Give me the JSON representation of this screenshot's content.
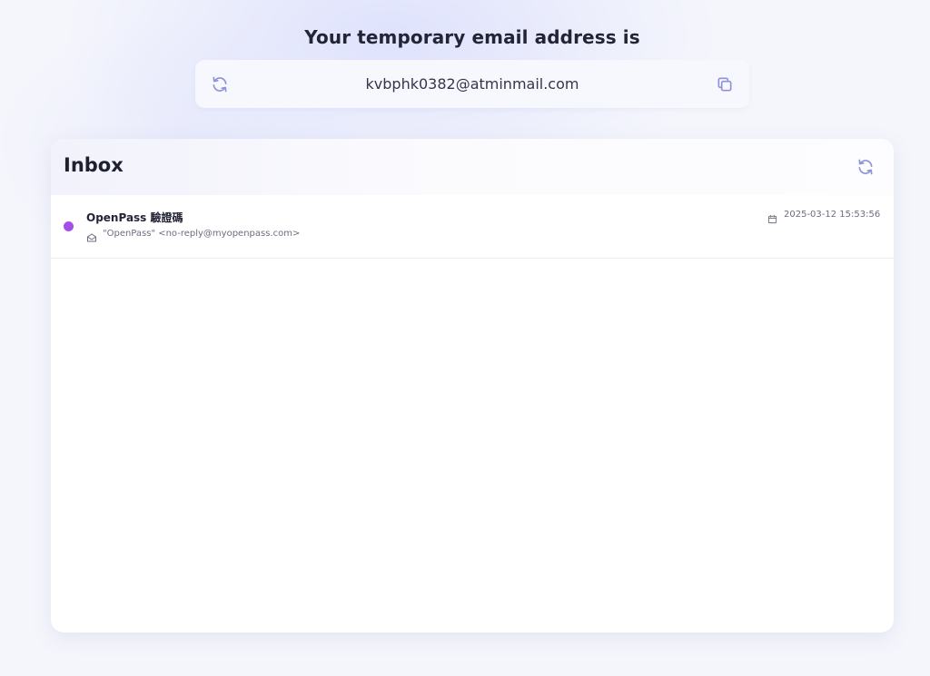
{
  "header": {
    "title": "Your temporary email address is"
  },
  "address": {
    "email": "kvbphk0382@atminmail.com",
    "refresh_icon": "refresh-icon",
    "copy_icon": "copy-icon"
  },
  "inbox": {
    "title": "Inbox",
    "refresh_icon": "refresh-icon",
    "messages": [
      {
        "subject": "OpenPass 驗證碼",
        "sender": "\"OpenPass\" <no-reply@myopenpass.com>",
        "date": "2025-03-12 15:53:56",
        "unread": true,
        "unread_color": "#a44ee8",
        "sender_icon": "envelope-open-icon",
        "date_icon": "calendar-icon"
      }
    ]
  },
  "colors": {
    "icon_accent": "#8e93d8",
    "unread_dot": "#a44ee8"
  }
}
